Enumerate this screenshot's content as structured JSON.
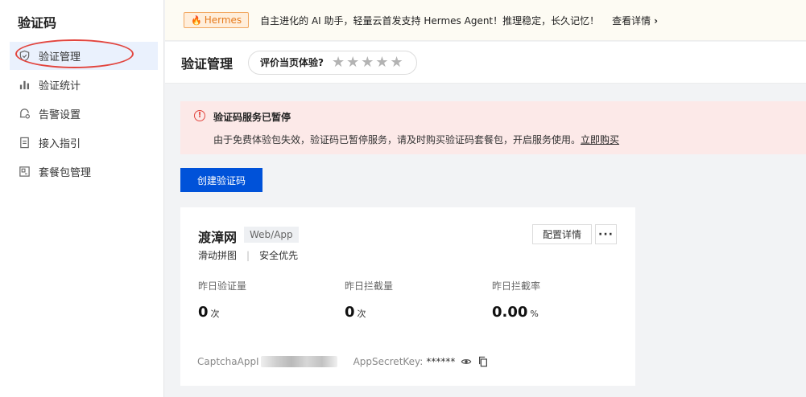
{
  "sidebar": {
    "title": "验证码",
    "items": [
      {
        "label": "验证管理",
        "icon": "shield-icon"
      },
      {
        "label": "验证统计",
        "icon": "bar-chart-icon"
      },
      {
        "label": "告警设置",
        "icon": "alarm-settings-icon"
      },
      {
        "label": "接入指引",
        "icon": "document-icon"
      },
      {
        "label": "套餐包管理",
        "icon": "package-icon"
      }
    ]
  },
  "banner": {
    "tag": "Hermes",
    "text": "自主进化的 AI 助手，轻量云首发支持 Hermes Agent！推理稳定，长久记忆！",
    "link": "查看详情"
  },
  "header": {
    "title": "验证管理",
    "rating_label": "评价当页体验?",
    "stars": [
      "★",
      "★",
      "★",
      "★",
      "★"
    ]
  },
  "alert": {
    "title": "验证码服务已暂停",
    "body": "由于免费体验包失效，验证码已暂停服务，请及时购买验证码套餐包，开启服务使用。",
    "link": "立即购买"
  },
  "create_button": "创建验证码",
  "card": {
    "name": "渡漳网",
    "tag": "Web/App",
    "config_button": "配置详情",
    "more_button": "···",
    "type": "滑动拼图",
    "separator": "|",
    "mode": "安全优先",
    "stats": [
      {
        "label": "昨日验证量",
        "value": "0",
        "unit": "次"
      },
      {
        "label": "昨日拦截量",
        "value": "0",
        "unit": "次"
      },
      {
        "label": "昨日拦截率",
        "value": "0.00",
        "unit": "%"
      }
    ],
    "app_id_label": "CaptchaAppI",
    "secret_label": "AppSecretKey:",
    "secret_value": "******"
  },
  "colors": {
    "primary": "#0052d9",
    "alert_bg": "#fce9e8",
    "alert_icon": "#e2453e",
    "active_nav": "#eaf1fd"
  }
}
